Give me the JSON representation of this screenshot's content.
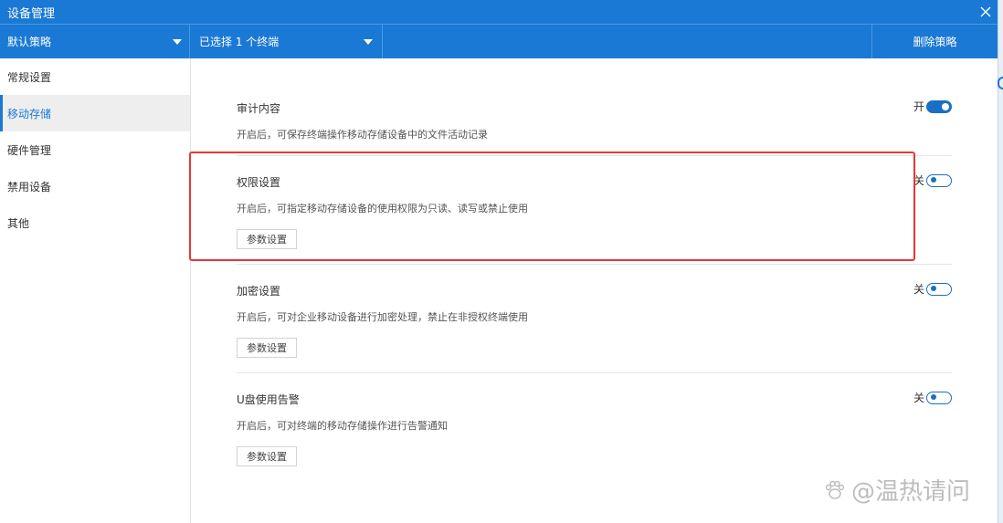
{
  "window": {
    "title": "设备管理"
  },
  "toolbar": {
    "policy_label": "默认策略",
    "terminal_label": "已选择 1 个终端",
    "delete_label": "删除策略"
  },
  "sidebar": {
    "items": [
      {
        "label": "常规设置",
        "active": false
      },
      {
        "label": "移动存储",
        "active": true
      },
      {
        "label": "硬件管理",
        "active": false
      },
      {
        "label": "禁用设备",
        "active": false
      },
      {
        "label": "其他",
        "active": false
      }
    ]
  },
  "sections": [
    {
      "title": "审计内容",
      "description": "开启后，可保存终端操作移动存储设备中的文件活动记录",
      "toggle_label": "开",
      "toggle_on": true
    },
    {
      "title": "权限设置",
      "description": "开启后，可指定移动存储设备的使用权限为只读、读写或禁止使用",
      "toggle_label": "关",
      "toggle_on": false,
      "button_label": "参数设置"
    },
    {
      "title": "加密设置",
      "description": "开启后，可对企业移动设备进行加密处理，禁止在非授权终端使用",
      "toggle_label": "关",
      "toggle_on": false,
      "button_label": "参数设置"
    },
    {
      "title": "U盘使用告警",
      "description": "开启后，可对终端的移动存储操作进行告警通知",
      "toggle_label": "关",
      "toggle_on": false,
      "button_label": "参数设置"
    }
  ],
  "watermark": {
    "text": "@温热请问"
  },
  "colors": {
    "primary": "#1a79d4",
    "highlight": "#e53935"
  },
  "icons": {
    "close": "close-icon",
    "dropdown": "chevron-down-icon"
  }
}
